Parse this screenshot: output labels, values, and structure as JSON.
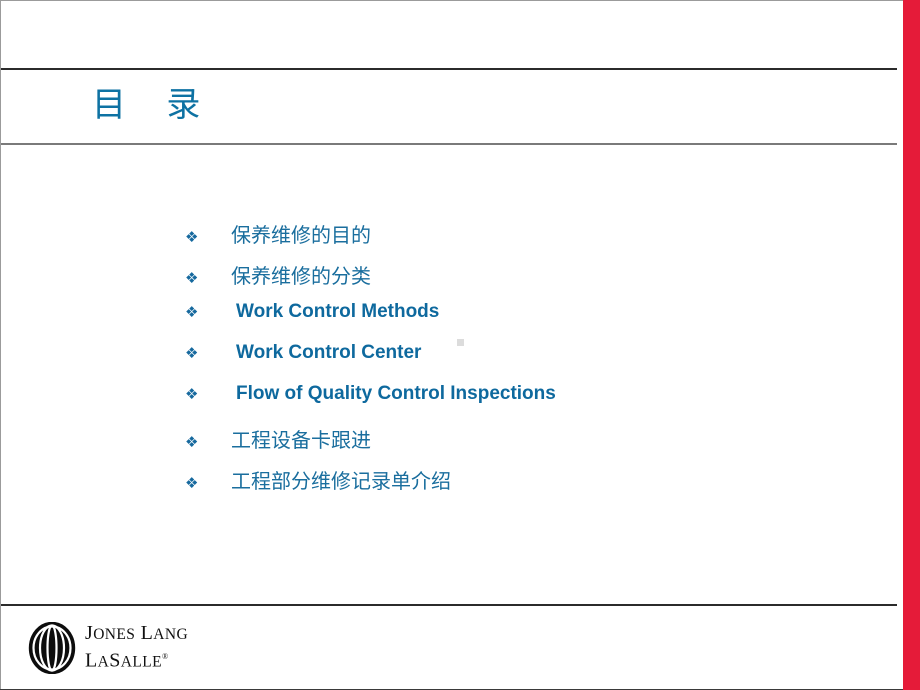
{
  "slide": {
    "title": "目   录",
    "title_color": "#0E72A3",
    "accent_bar_color": "#E51B39",
    "bullet_glyph": "❖",
    "bullet_color": "#16699E",
    "text_color_cn": "#1A6E9E",
    "text_color_en": "#0E699E"
  },
  "toc": {
    "items": [
      {
        "label": "保养维修的目的",
        "lang": "cn"
      },
      {
        "label": "保养维修的分类",
        "lang": "cn"
      },
      {
        "label": "Work Control Methods",
        "lang": "en"
      },
      {
        "label": "Work Control Center",
        "lang": "en"
      },
      {
        "label": "Flow of Quality Control Inspections",
        "lang": "en"
      },
      {
        "label": "工程设备卡跟进",
        "lang": "cn"
      },
      {
        "label": "工程部分维修记录单介绍",
        "lang": "cn"
      }
    ]
  },
  "footer": {
    "logo": {
      "mark": "jll-globe-icon",
      "line1_caps": "J",
      "line1_rest": "ONES ",
      "line1_caps2": "L",
      "line1_rest2": "ANG",
      "line1": "JONES LANG",
      "line2": "LASALLE",
      "registered_mark": "®"
    }
  }
}
